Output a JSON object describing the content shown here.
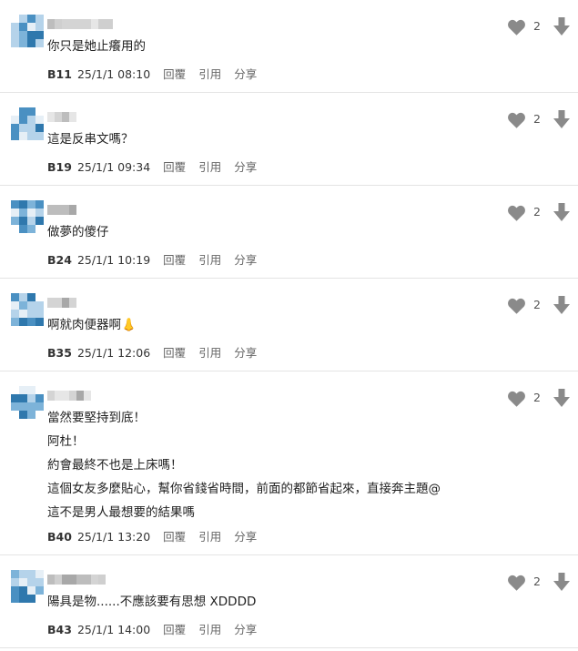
{
  "comments": [
    {
      "id": "c1",
      "lines": [
        "你只是她止癢用的"
      ],
      "floor": "B11",
      "time": "25/1/1 08:10",
      "likes": "2"
    },
    {
      "id": "c2",
      "lines": [
        "這是反串文嗎？"
      ],
      "floor": "B19",
      "time": "25/1/1 09:34",
      "likes": "2"
    },
    {
      "id": "c3",
      "lines": [
        "做夢的傻仔"
      ],
      "floor": "B24",
      "time": "25/1/1 10:19",
      "likes": "2"
    },
    {
      "id": "c4",
      "lines": [
        "啊就肉便器啊👃"
      ],
      "floor": "B35",
      "time": "25/1/1 12:06",
      "likes": "2"
    },
    {
      "id": "c5",
      "lines": [
        "當然要堅持到底！",
        "阿杜！",
        "約會最終不也是上床嗎！",
        "這個女友多麼貼心，幫你省錢省時間，前面的都節省起來，直接奔主題@",
        "這不是男人最想要的結果嗎"
      ],
      "floor": "B40",
      "time": "25/1/1 13:20",
      "likes": "2"
    },
    {
      "id": "c6",
      "lines": [
        "陽具是物......不應該要有思想 XDDDD"
      ],
      "floor": "B43",
      "time": "25/1/1 14:00",
      "likes": "2"
    }
  ],
  "actions": {
    "reply": "回覆",
    "quote": "引用",
    "share": "分享"
  },
  "icons": {
    "like": "heart-icon",
    "dislike": "arrow-down-icon"
  },
  "colors": {
    "icon": "#8a8a8a",
    "divider": "#e4e4e4",
    "avatar": [
      "#4a90c2",
      "#7db3d9",
      "#b5d3ea",
      "#2f78ad",
      "#e6eff6"
    ]
  }
}
